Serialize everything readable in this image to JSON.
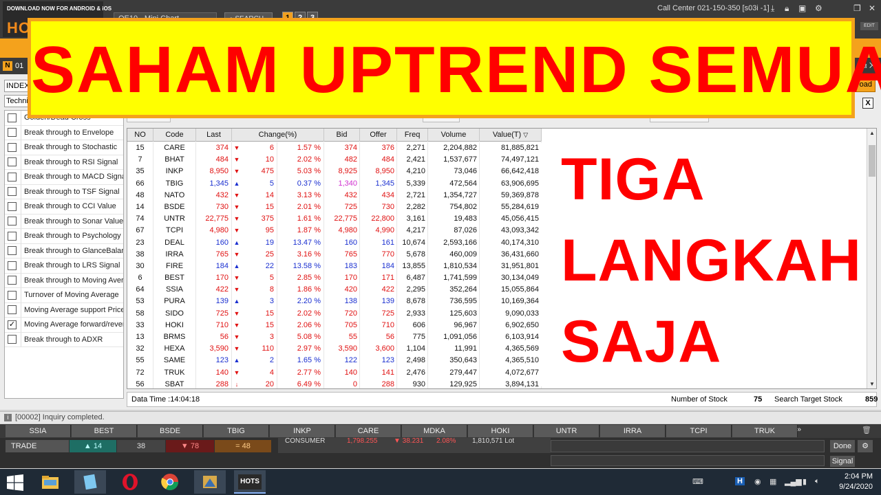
{
  "topbar": {
    "download_text": "DOWNLOAD NOW FOR ANDROID & iOS",
    "logo": "HOTS",
    "chart_selector": "OE10 - Mini Chart",
    "search_label": "SEARCH",
    "pages": [
      "1",
      "2",
      "3"
    ],
    "call_center": "Call Center 021-150-350 [s03i -1]",
    "edit_label": "EDIT"
  },
  "subbar": {
    "n_label": "N",
    "screen_no": "01"
  },
  "controls": {
    "index_value": "INDEX",
    "tech_value": "Technical",
    "load_label": "oad",
    "close_label": "X"
  },
  "conditions": [
    {
      "label": "Golden/Dead Cross",
      "checked": false
    },
    {
      "label": "Break through to Envelope",
      "checked": false
    },
    {
      "label": "Break through to Stochastic",
      "checked": false
    },
    {
      "label": "Break through to RSI Signal",
      "checked": false
    },
    {
      "label": "Break through to MACD Signal",
      "checked": false
    },
    {
      "label": "Break through to TSF Signal",
      "checked": false
    },
    {
      "label": "Break through to CCI Value",
      "checked": false
    },
    {
      "label": "Break through to Sonar Value",
      "checked": false
    },
    {
      "label": "Break through to Psychology",
      "checked": false
    },
    {
      "label": "Break through to GlanceBalance",
      "checked": false
    },
    {
      "label": "Break through to LRS Signal",
      "checked": false
    },
    {
      "label": "Break through to Moving Average",
      "checked": false
    },
    {
      "label": "Turnover of Moving Average",
      "checked": false
    },
    {
      "label": "Moving Average support Price",
      "checked": false
    },
    {
      "label": "Moving Average forward/reverse",
      "checked": true
    },
    {
      "label": "Break through to ADXR",
      "checked": false
    }
  ],
  "grid": {
    "headers": {
      "no": "NO",
      "code": "Code",
      "last": "Last",
      "change": "Change(%)",
      "bid": "Bid",
      "offer": "Offer",
      "freq": "Freq",
      "volume": "Volume",
      "value": "Value(T)"
    },
    "rows": [
      {
        "no": "15",
        "code": "CARE",
        "last": "374",
        "arrow": "▼",
        "dir": "red",
        "chg": "6",
        "pct": "1.57 %",
        "bid": "374",
        "offer": "376",
        "freq": "2,271",
        "vol": "2,204,882",
        "val": "81,885,821"
      },
      {
        "no": "7",
        "code": "BHAT",
        "last": "484",
        "arrow": "▼",
        "dir": "red",
        "chg": "10",
        "pct": "2.02 %",
        "bid": "482",
        "offer": "484",
        "freq": "2,421",
        "vol": "1,537,677",
        "val": "74,497,121"
      },
      {
        "no": "35",
        "code": "INKP",
        "last": "8,950",
        "arrow": "▼",
        "dir": "red",
        "chg": "475",
        "pct": "5.03 %",
        "bid": "8,925",
        "offer": "8,950",
        "freq": "4,210",
        "vol": "73,046",
        "val": "66,642,418"
      },
      {
        "no": "66",
        "code": "TBIG",
        "last": "1,345",
        "arrow": "▲",
        "dir": "blue",
        "chg": "5",
        "pct": "0.37 %",
        "bid": "1,340",
        "offer": "1,345",
        "freq": "5,339",
        "vol": "472,564",
        "val": "63,906,695"
      },
      {
        "no": "48",
        "code": "NATO",
        "last": "432",
        "arrow": "▼",
        "dir": "red",
        "chg": "14",
        "pct": "3.13 %",
        "bid": "432",
        "offer": "434",
        "freq": "2,721",
        "vol": "1,354,727",
        "val": "59,369,878"
      },
      {
        "no": "14",
        "code": "BSDE",
        "last": "730",
        "arrow": "▼",
        "dir": "red",
        "chg": "15",
        "pct": "2.01 %",
        "bid": "725",
        "offer": "730",
        "freq": "2,282",
        "vol": "754,802",
        "val": "55,284,619"
      },
      {
        "no": "74",
        "code": "UNTR",
        "last": "22,775",
        "arrow": "▼",
        "dir": "red",
        "chg": "375",
        "pct": "1.61 %",
        "bid": "22,775",
        "offer": "22,800",
        "freq": "3,161",
        "vol": "19,483",
        "val": "45,056,415"
      },
      {
        "no": "67",
        "code": "TCPI",
        "last": "4,980",
        "arrow": "▼",
        "dir": "red",
        "chg": "95",
        "pct": "1.87 %",
        "bid": "4,980",
        "offer": "4,990",
        "freq": "4,217",
        "vol": "87,026",
        "val": "43,093,342"
      },
      {
        "no": "23",
        "code": "DEAL",
        "last": "160",
        "arrow": "▲",
        "dir": "blue",
        "chg": "19",
        "pct": "13.47 %",
        "bid": "160",
        "offer": "161",
        "freq": "10,674",
        "vol": "2,593,166",
        "val": "40,174,310"
      },
      {
        "no": "38",
        "code": "IRRA",
        "last": "765",
        "arrow": "▼",
        "dir": "red",
        "chg": "25",
        "pct": "3.16 %",
        "bid": "765",
        "offer": "770",
        "freq": "5,678",
        "vol": "460,009",
        "val": "36,431,660"
      },
      {
        "no": "30",
        "code": "FIRE",
        "last": "184",
        "arrow": "▲",
        "dir": "blue",
        "chg": "22",
        "pct": "13.58 %",
        "bid": "183",
        "offer": "184",
        "freq": "13,855",
        "vol": "1,810,534",
        "val": "31,951,801"
      },
      {
        "no": "6",
        "code": "BEST",
        "last": "170",
        "arrow": "▼",
        "dir": "red",
        "chg": "5",
        "pct": "2.85 %",
        "bid": "170",
        "offer": "171",
        "freq": "6,487",
        "vol": "1,741,599",
        "val": "30,134,049"
      },
      {
        "no": "64",
        "code": "SSIA",
        "last": "422",
        "arrow": "▼",
        "dir": "red",
        "chg": "8",
        "pct": "1.86 %",
        "bid": "420",
        "offer": "422",
        "freq": "2,295",
        "vol": "352,264",
        "val": "15,055,864"
      },
      {
        "no": "53",
        "code": "PURA",
        "last": "139",
        "arrow": "▲",
        "dir": "blue",
        "chg": "3",
        "pct": "2.20 %",
        "bid": "138",
        "offer": "139",
        "freq": "8,678",
        "vol": "736,595",
        "val": "10,169,364"
      },
      {
        "no": "58",
        "code": "SIDO",
        "last": "725",
        "arrow": "▼",
        "dir": "red",
        "chg": "15",
        "pct": "2.02 %",
        "bid": "720",
        "offer": "725",
        "freq": "2,933",
        "vol": "125,603",
        "val": "9,090,033"
      },
      {
        "no": "33",
        "code": "HOKI",
        "last": "710",
        "arrow": "▼",
        "dir": "red",
        "chg": "15",
        "pct": "2.06 %",
        "bid": "705",
        "offer": "710",
        "freq": "606",
        "vol": "96,967",
        "val": "6,902,650"
      },
      {
        "no": "13",
        "code": "BRMS",
        "last": "56",
        "arrow": "▼",
        "dir": "red",
        "chg": "3",
        "pct": "5.08 %",
        "bid": "55",
        "offer": "56",
        "freq": "775",
        "vol": "1,091,056",
        "val": "6,103,914"
      },
      {
        "no": "32",
        "code": "HEXA",
        "last": "3,590",
        "arrow": "▼",
        "dir": "red",
        "chg": "110",
        "pct": "2.97 %",
        "bid": "3,590",
        "offer": "3,600",
        "freq": "1,104",
        "vol": "11,991",
        "val": "4,365,569"
      },
      {
        "no": "55",
        "code": "SAME",
        "last": "123",
        "arrow": "▲",
        "dir": "blue",
        "chg": "2",
        "pct": "1.65 %",
        "bid": "122",
        "offer": "123",
        "freq": "2,498",
        "vol": "350,643",
        "val": "4,365,510"
      },
      {
        "no": "72",
        "code": "TRUK",
        "last": "140",
        "arrow": "▼",
        "dir": "red",
        "chg": "4",
        "pct": "2.77 %",
        "bid": "140",
        "offer": "141",
        "freq": "2,476",
        "vol": "279,447",
        "val": "4,072,677"
      },
      {
        "no": "56",
        "code": "SBAT",
        "last": "288",
        "arrow": "↓",
        "dir": "red",
        "chg": "20",
        "pct": "6.49 %",
        "bid": "0",
        "offer": "288",
        "freq": "930",
        "vol": "129,925",
        "val": "3,894,131"
      }
    ]
  },
  "status": {
    "data_time": "Data Time :14:04:18",
    "number_of_stock_label": "Number of Stock",
    "number_of_stock": "75",
    "search_target_label": "Search Target Stock",
    "search_target": "859"
  },
  "inquiry": "[00002] Inquiry completed.",
  "ticker": [
    "SSIA",
    "BEST",
    "BSDE",
    "TBIG",
    "INKP",
    "CARE",
    "MDKA",
    "HOKI",
    "UNTR",
    "IRRA",
    "TCPI",
    "TRUK"
  ],
  "ticker_more": "»",
  "trade": {
    "label": "TRADE",
    "up": "▲ 14",
    "flat": "38",
    "down": "▼ 78",
    "eq": "= 48",
    "sector": "CONSUMER",
    "sector_value": "1,798.255",
    "sector_change": "▼ 38.231",
    "sector_pct": "2.08%",
    "sector_lot": "1,810,571 Lot",
    "done": "Done",
    "signal": "Signal"
  },
  "overlay": {
    "banner": "SAHAM UPTREND SEMUA",
    "line1": "TIGA",
    "line2": "LANGKAH",
    "line3": "SAJA"
  },
  "taskbar": {
    "hots_label": "HOTS",
    "time": "2:04 PM",
    "date": "9/24/2020"
  },
  "colors": {
    "banner_bg": "#ffff00",
    "banner_text": "#ff0000",
    "accent_orange": "#f4a21c",
    "down_red": "#e01010",
    "up_blue": "#1a2fd0"
  }
}
